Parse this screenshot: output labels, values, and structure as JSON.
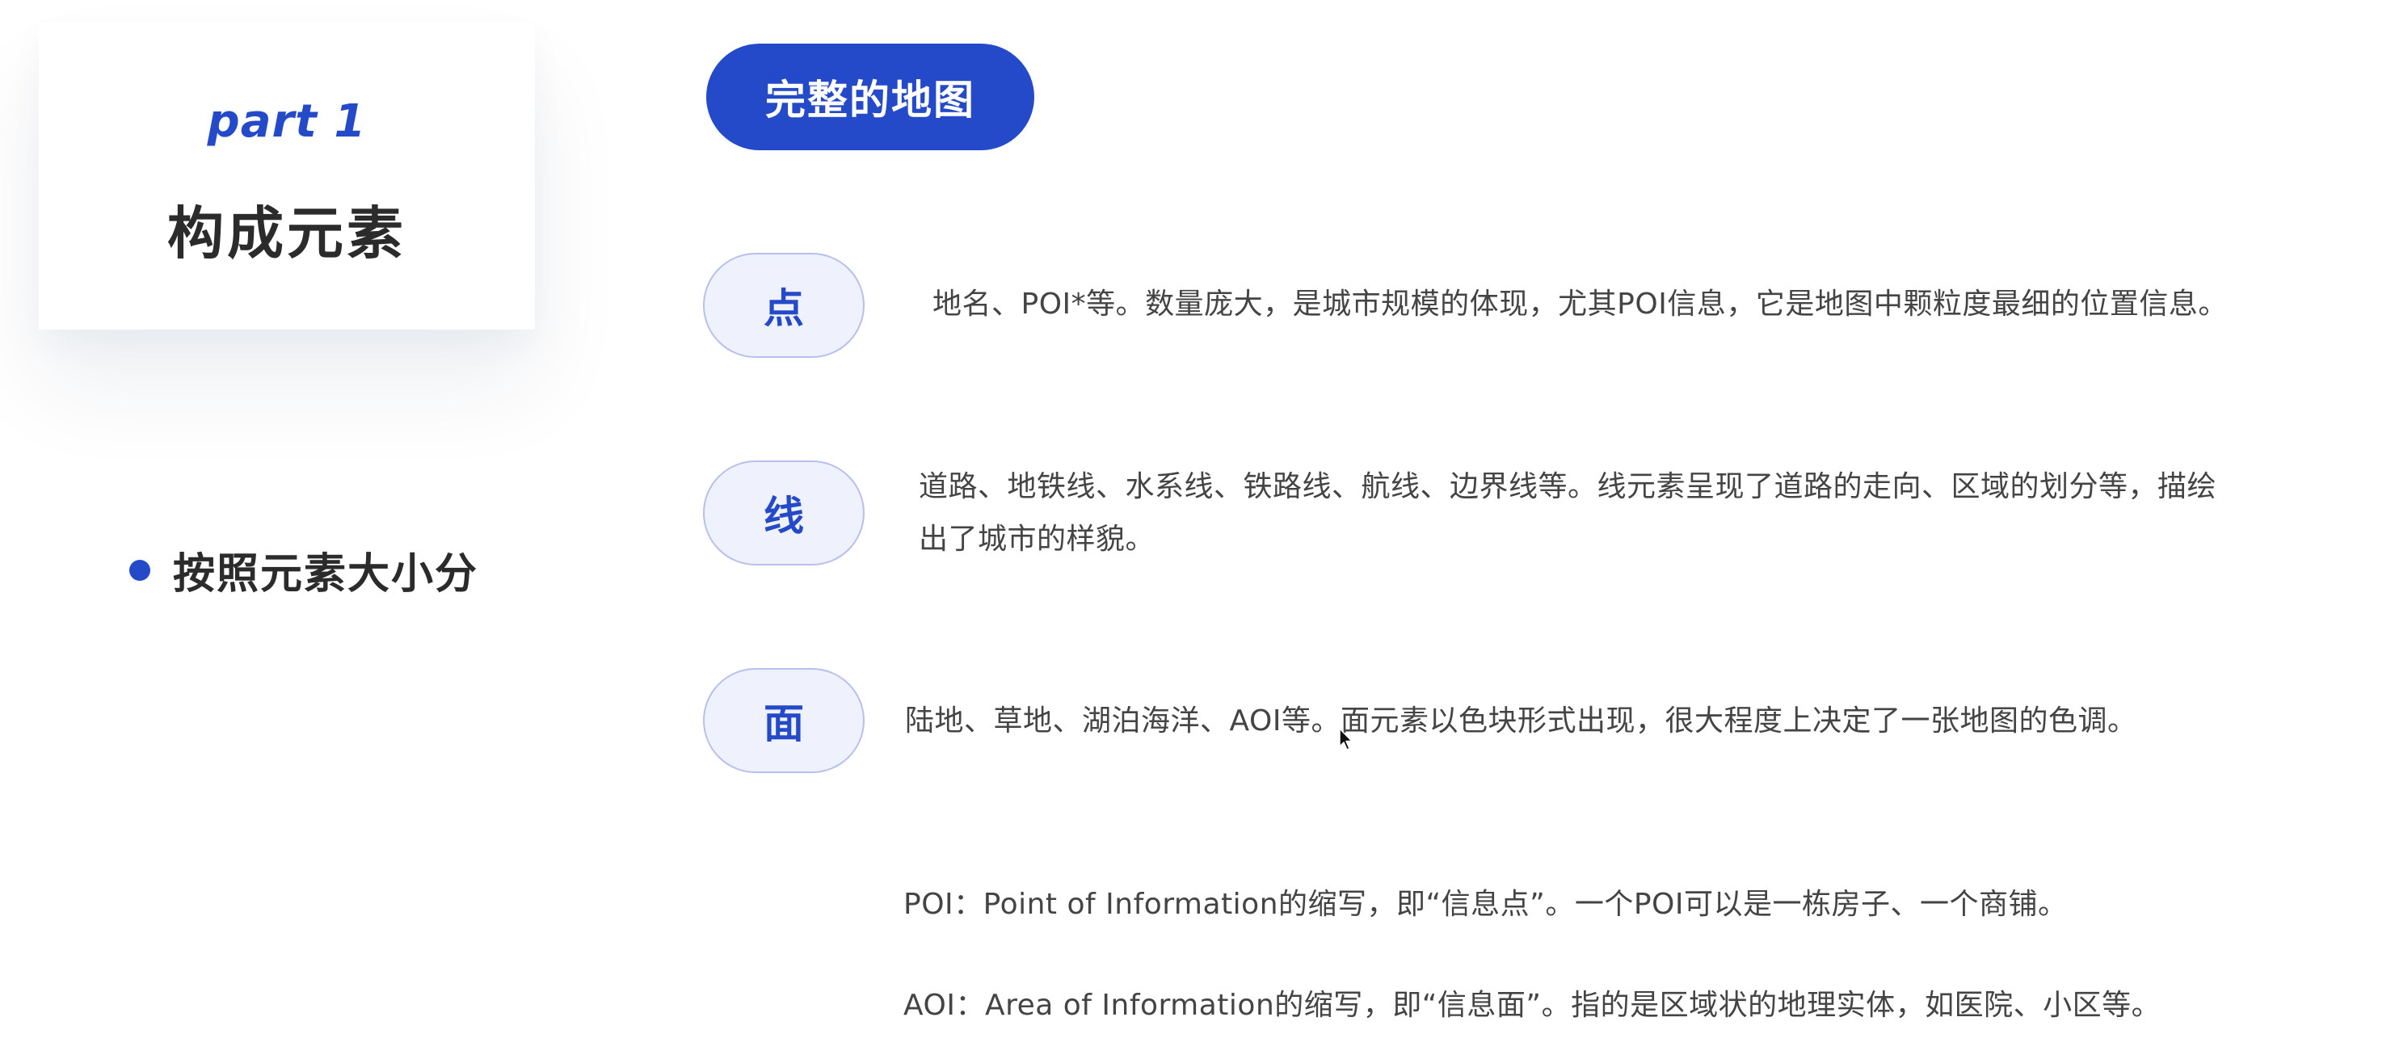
{
  "title_card": {
    "part": "part 1",
    "title": "构成元素"
  },
  "category": {
    "label": "按照元素大小分"
  },
  "header": {
    "label": "完整的地图"
  },
  "elements": [
    {
      "name": "点",
      "description": "地名、POI*等。数量庞大，是城市规模的体现，尤其POI信息，它是地图中颗粒度最细的位置信息。"
    },
    {
      "name": "线",
      "description_lines": [
        "道路、地铁线、水系线、铁路线、航线、边界线等。线元素呈现了道路的走向、区域的划分等，描绘",
        "出了城市的样貌。"
      ]
    },
    {
      "name": "面",
      "description": "陆地、草地、湖泊海洋、AOI等。面元素以色块形式出现，很大程度上决定了一张地图的色调。"
    }
  ],
  "notes": {
    "poi": "POI：Point of Information的缩写，即“信息点”。一个POI可以是一栋房子、一个商铺。",
    "aoi": "AOI：Area of Information的缩写，即“信息面”。指的是区域状的地理实体，如医院、小区等。"
  },
  "colors": {
    "accent": "#2449c9",
    "pill_fill": "#eff1fc",
    "pill_border": "#b7c0ec",
    "text": "#444444"
  },
  "icons": {
    "cursor": "mouse-pointer-icon",
    "bullet": "bullet-dot-icon"
  }
}
